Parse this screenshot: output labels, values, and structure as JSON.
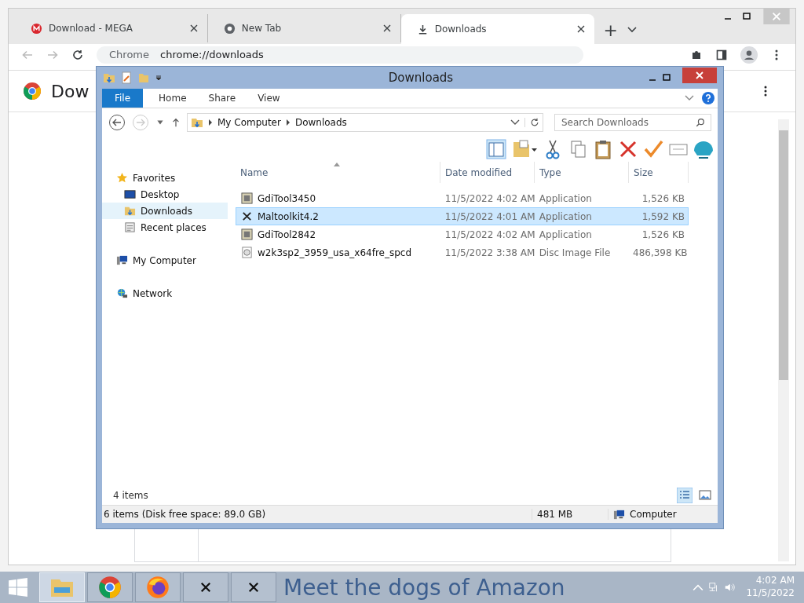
{
  "browser": {
    "tabs": [
      {
        "title": "Download - MEGA",
        "selected": false
      },
      {
        "title": "New Tab",
        "selected": false
      },
      {
        "title": "Downloads",
        "selected": true
      }
    ],
    "new_tab_button": "+",
    "address": {
      "site_label": "Chrome",
      "url": "chrome://downloads"
    },
    "page_title": "Dow"
  },
  "explorer": {
    "title": "Downloads",
    "ribbon_tabs": [
      {
        "label": "File",
        "kind": "file"
      },
      {
        "label": "Home",
        "kind": "tab"
      },
      {
        "label": "Share",
        "kind": "tab"
      },
      {
        "label": "View",
        "kind": "tab"
      }
    ],
    "breadcrumb": [
      "My Computer",
      "Downloads"
    ],
    "search": {
      "placeholder": "Search Downloads"
    },
    "nav": [
      {
        "label": "Favorites",
        "selected": false,
        "children": [
          {
            "label": "Desktop",
            "selected": false
          },
          {
            "label": "Downloads",
            "selected": true
          },
          {
            "label": "Recent places",
            "selected": false
          }
        ]
      },
      {
        "label": "My Computer",
        "selected": false
      },
      {
        "label": "Network",
        "selected": false
      }
    ],
    "columns": [
      "Name",
      "Date modified",
      "Type",
      "Size"
    ],
    "files": [
      {
        "name": "GdiTool3450",
        "date": "11/5/2022 4:02 AM",
        "type": "Application",
        "size": "1,526 KB",
        "kind": "app",
        "selected": false
      },
      {
        "name": "Maltoolkit4.2",
        "date": "11/5/2022 4:01 AM",
        "type": "Application",
        "size": "1,592 KB",
        "kind": "tool",
        "selected": true
      },
      {
        "name": "GdiTool2842",
        "date": "11/5/2022 4:02 AM",
        "type": "Application",
        "size": "1,526 KB",
        "kind": "app",
        "selected": false
      },
      {
        "name": "w2k3sp2_3959_usa_x64fre_spcd",
        "date": "11/5/2022 3:38 AM",
        "type": "Disc Image File",
        "size": "486,398 KB",
        "kind": "disc",
        "selected": false
      }
    ],
    "item_count": "4 items",
    "status": {
      "summary": "6 items (Disk free space: 89.0 GB)",
      "size": "481 MB",
      "location": "Computer"
    }
  },
  "taskbar": {
    "apps": [
      {
        "selected": true
      },
      {
        "selected": false
      },
      {
        "selected": false
      },
      {
        "selected": false
      },
      {
        "selected": false
      }
    ],
    "wallpaper_text": "Meet the dogs of Amazon",
    "time": "4:02 AM",
    "date": "11/5/2022"
  }
}
